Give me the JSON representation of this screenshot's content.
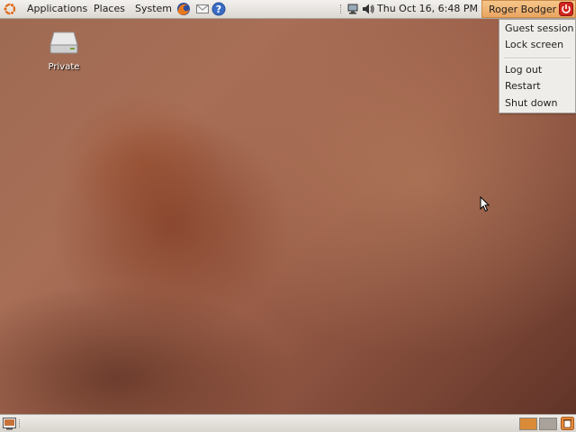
{
  "top_panel": {
    "menus": [
      "Applications",
      "Places",
      "System"
    ],
    "launchers": [
      "firefox-icon",
      "mail-icon",
      "help-icon"
    ],
    "tray_icons": [
      "network-icon",
      "volume-icon"
    ],
    "clock": "Thu Oct 16,  6:48 PM",
    "user": "Roger Bodger"
  },
  "user_menu": {
    "items": [
      "Guest session",
      "Lock screen",
      "Log out",
      "Restart",
      "Shut down"
    ]
  },
  "desktop": {
    "icon_label": "Private",
    "icon_name": "drive-icon"
  },
  "bottom_panel": {
    "workspaces": 2,
    "active_workspace": 1,
    "icons": [
      "show-desktop-icon",
      "trash-icon"
    ]
  },
  "colors": {
    "user_button": "#e9a460",
    "power_red": "#d0261e",
    "workspace_active": "#d98b38",
    "workspace_inactive": "#a8a29b"
  }
}
